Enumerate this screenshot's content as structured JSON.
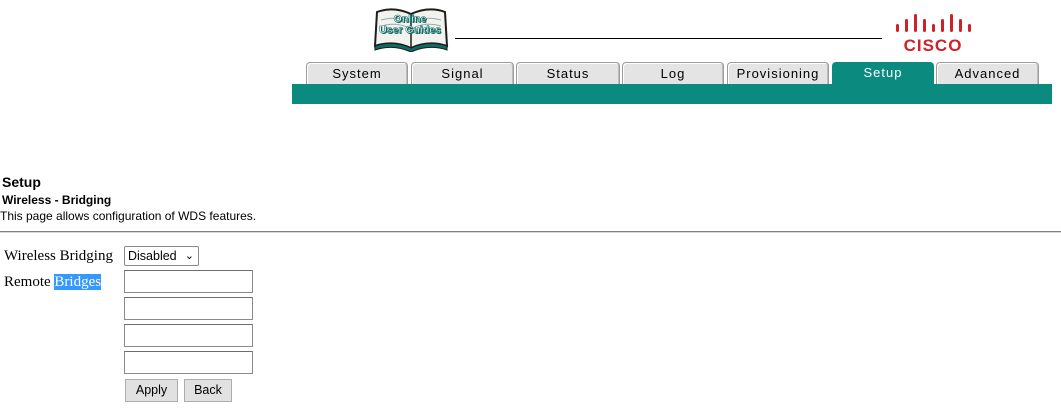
{
  "header": {
    "guides_logo_line1": "Online",
    "guides_logo_line2": "User Guides",
    "brand_name": "CISCO"
  },
  "tabs": [
    {
      "label": "System",
      "active": false
    },
    {
      "label": "Signal",
      "active": false
    },
    {
      "label": "Status",
      "active": false
    },
    {
      "label": "Log",
      "active": false
    },
    {
      "label": "Provisioning",
      "active": false
    },
    {
      "label": "Setup",
      "active": true
    },
    {
      "label": "Advanced",
      "active": false
    }
  ],
  "page": {
    "title": "Setup",
    "subtitle": "Wireless - Bridging",
    "description": "This page allows configuration of WDS features."
  },
  "form": {
    "wireless_bridging_label": "Wireless Bridging",
    "wireless_bridging_value": "Disabled",
    "remote_label_prefix": "Remote",
    "remote_label_highlighted": "Bridges",
    "remote_bridges": [
      {
        "value": ""
      },
      {
        "value": ""
      },
      {
        "value": ""
      },
      {
        "value": ""
      }
    ]
  },
  "buttons": {
    "apply": "Apply",
    "back": "Back"
  },
  "colors": {
    "accent_teal": "#0b8a80",
    "cisco_red": "#d0202a",
    "selection_blue": "#3399ff"
  }
}
